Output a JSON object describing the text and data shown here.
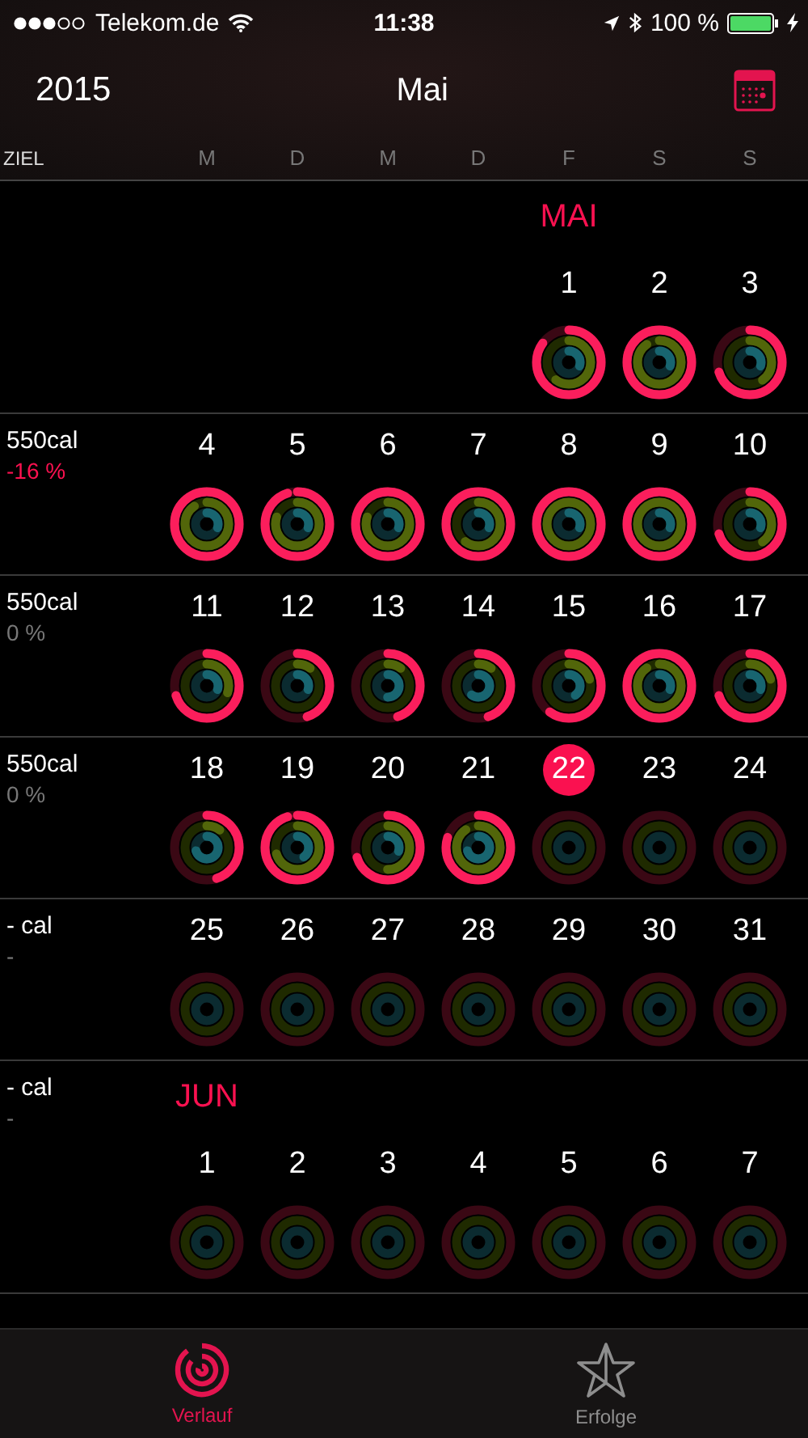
{
  "status_bar": {
    "carrier": "Telekom.de",
    "time": "11:38",
    "battery": "100 %"
  },
  "header": {
    "year": "2015",
    "title": "Mai"
  },
  "weekday_header": {
    "goal_heading": "ZIEL",
    "days": [
      "M",
      "D",
      "M",
      "D",
      "F",
      "S",
      "S"
    ]
  },
  "weeks": [
    {
      "month": "MAI",
      "days": [
        {
          "n": "1",
          "today": false
        },
        {
          "n": "2",
          "today": false
        },
        {
          "n": "3",
          "today": false
        }
      ]
    },
    {
      "goal": "550cal",
      "change": "-16 %",
      "below_goal": true,
      "days": [
        {
          "n": "4",
          "today": false
        },
        {
          "n": "5",
          "today": false
        },
        {
          "n": "6",
          "today": false
        },
        {
          "n": "7",
          "today": false
        },
        {
          "n": "8",
          "today": false
        },
        {
          "n": "9",
          "today": false
        },
        {
          "n": "10",
          "today": false
        }
      ]
    },
    {
      "goal": "550cal",
      "change": "0 %",
      "below_goal": false,
      "days": [
        {
          "n": "11",
          "today": false
        },
        {
          "n": "12",
          "today": false
        },
        {
          "n": "13",
          "today": false
        },
        {
          "n": "14",
          "today": false
        },
        {
          "n": "15",
          "today": false
        },
        {
          "n": "16",
          "today": false
        },
        {
          "n": "17",
          "today": false
        }
      ]
    },
    {
      "goal": "550cal",
      "change": "0 %",
      "below_goal": false,
      "days": [
        {
          "n": "18",
          "today": false
        },
        {
          "n": "19",
          "today": false
        },
        {
          "n": "20",
          "today": false
        },
        {
          "n": "21",
          "today": false
        },
        {
          "n": "22",
          "today": true
        },
        {
          "n": "23",
          "today": false
        },
        {
          "n": "24",
          "today": false
        }
      ]
    },
    {
      "goal": "- cal",
      "change": "-",
      "below_goal": false,
      "days": [
        {
          "n": "25",
          "today": false
        },
        {
          "n": "26",
          "today": false
        },
        {
          "n": "27",
          "today": false
        },
        {
          "n": "28",
          "today": false
        },
        {
          "n": "29",
          "today": false
        },
        {
          "n": "30",
          "today": false
        },
        {
          "n": "31",
          "today": false
        }
      ]
    },
    {
      "goal": "- cal",
      "change": "-",
      "below_goal": false,
      "month": "JUN",
      "days": [
        {
          "n": "1",
          "today": false
        },
        {
          "n": "2",
          "today": false
        },
        {
          "n": "3",
          "today": false
        },
        {
          "n": "4",
          "today": false
        },
        {
          "n": "5",
          "today": false
        },
        {
          "n": "6",
          "today": false
        },
        {
          "n": "7",
          "today": false
        }
      ]
    }
  ],
  "tab_bar": [
    {
      "label": "Verlauf",
      "kind": "history",
      "selected": true
    },
    {
      "label": "Erfolge",
      "kind": "awards",
      "selected": false
    }
  ]
}
